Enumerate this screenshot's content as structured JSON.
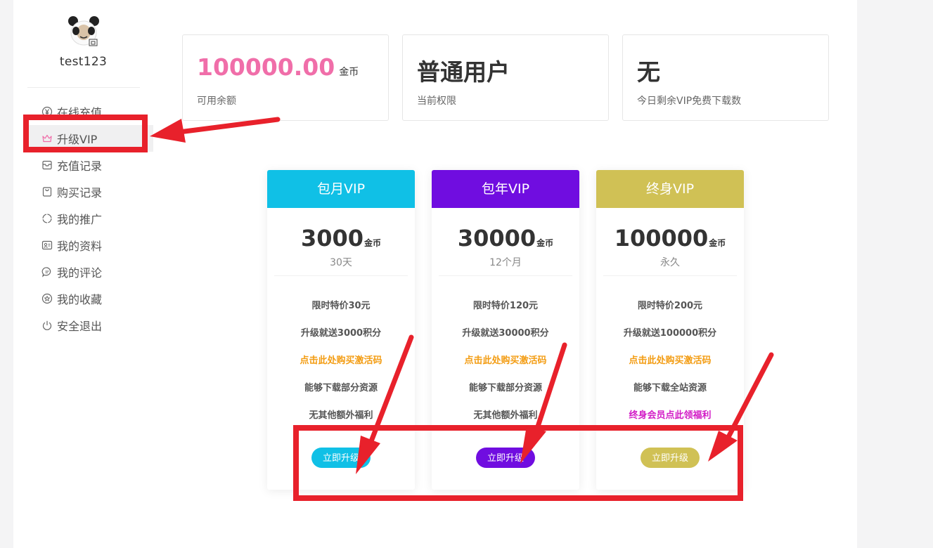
{
  "sidebar": {
    "username": "test123",
    "items": [
      {
        "label": "在线充值",
        "icon": "yen-coin-icon"
      },
      {
        "label": "升级VIP",
        "icon": "crown-icon"
      },
      {
        "label": "充值记录",
        "icon": "inbox-icon"
      },
      {
        "label": "购买记录",
        "icon": "shopping-bag-icon"
      },
      {
        "label": "我的推广",
        "icon": "circle-notch-icon"
      },
      {
        "label": "我的资料",
        "icon": "profile-card-icon"
      },
      {
        "label": "我的评论",
        "icon": "comment-icon"
      },
      {
        "label": "我的收藏",
        "icon": "star-circle-icon"
      },
      {
        "label": "安全退出",
        "icon": "power-icon"
      }
    ]
  },
  "stats": [
    {
      "value": "100000.00",
      "unit": "金币",
      "label": "可用余额"
    },
    {
      "value": "普通用户",
      "unit": "",
      "label": "当前权限"
    },
    {
      "value": "无",
      "unit": "",
      "label": "今日剩余VIP免费下载数"
    }
  ],
  "plans": [
    {
      "title": "包月VIP",
      "price": "3000",
      "unit": "金币",
      "period": "30天",
      "features": [
        "限时特价30元",
        "升级就送3000积分",
        "点击此处购买激活码",
        "能够下载部分资源",
        "无其他额外福利"
      ],
      "button": "立即升级",
      "color": "#10c0e6"
    },
    {
      "title": "包年VIP",
      "price": "30000",
      "unit": "金币",
      "period": "12个月",
      "features": [
        "限时特价120元",
        "升级就送30000积分",
        "点击此处购买激活码",
        "能够下载部分资源",
        "无其他额外福利"
      ],
      "button": "立即升级",
      "color": "#700de0"
    },
    {
      "title": "终身VIP",
      "price": "100000",
      "unit": "金币",
      "period": "永久",
      "features": [
        "限时特价200元",
        "升级就送100000积分",
        "点击此处购买激活码",
        "能够下载全站资源",
        "终身会员点此领福利"
      ],
      "button": "立即升级",
      "color": "#d0c155"
    }
  ],
  "colors": {
    "pink_balance": "#f06ea9",
    "annotation_red": "#e8212b",
    "link_orange": "#f39c12",
    "link_magenta": "#d21cc6"
  }
}
